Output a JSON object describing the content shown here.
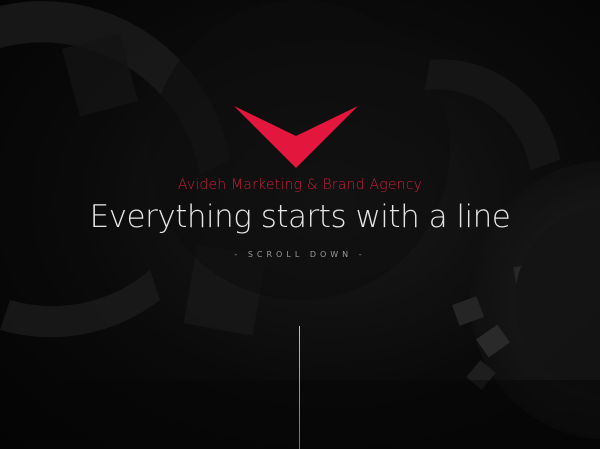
{
  "hero": {
    "agency_name": "Avideh Marketing & Brand Agency",
    "headline": "Everything starts with a line",
    "scroll_label": "- SCROLL DOWN -"
  },
  "brand": {
    "logo_icon": "red-chevron-logo",
    "accent_color": "#e3173e",
    "background_color": "#050505"
  }
}
